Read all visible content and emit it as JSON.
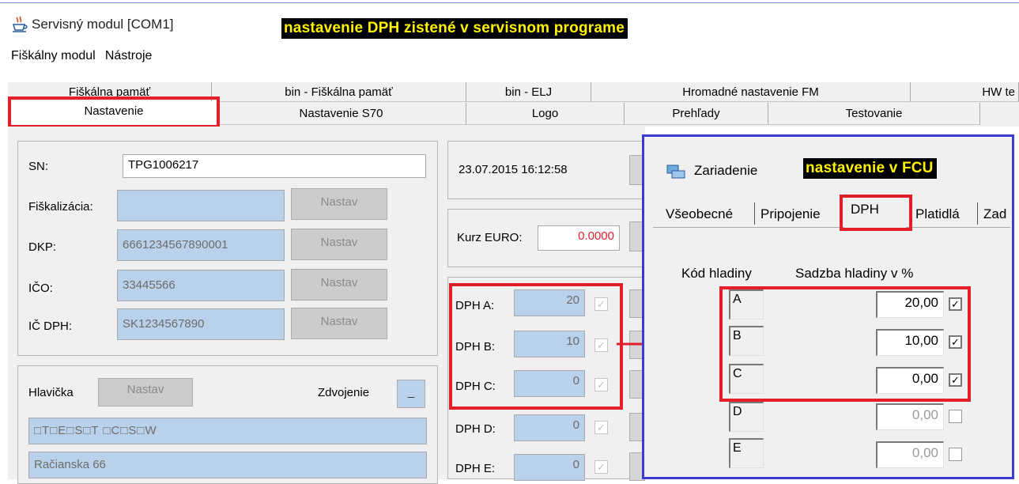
{
  "window": {
    "title": "Servisný modul [COM1]",
    "highlight": "nastavenie DPH zistené v servisnom programe"
  },
  "menu": {
    "items": [
      "Fiškálny modul",
      "Nástroje"
    ]
  },
  "tabs": {
    "row1": [
      "Fiškálna pamäť",
      "bin - Fiškálna pamäť",
      "bin - ELJ",
      "Hromadné nastavenie FM",
      "HW te"
    ],
    "row2": [
      "Nastavenie",
      "Nastavenie S70",
      "Logo",
      "Prehľady",
      "Testovanie"
    ],
    "active": "Nastavenie"
  },
  "form": {
    "sn_label": "SN:",
    "sn_value": "TPG1006217",
    "fisk_label": "Fiškalizácia:",
    "fisk_value": "",
    "dkp_label": "DKP:",
    "dkp_value": "6661234567890001",
    "ico_label": "IČO:",
    "ico_value": "33445566",
    "icdph_label": "IČ DPH:",
    "icdph_value": "SK1234567890",
    "set_button": "Nastav",
    "header_label": "Hlavička",
    "double_label": "Zdvojenie",
    "double_button": "_",
    "header_line1": "□T□E□S□T □C□S□W",
    "header_line2": "Račianska 66"
  },
  "datetime": "23.07.2015 16:12:58",
  "euro": {
    "label": "Kurz EURO:",
    "value": "0.0000"
  },
  "vat": [
    {
      "label": "DPH A:",
      "value": "20"
    },
    {
      "label": "DPH B:",
      "value": "10"
    },
    {
      "label": "DPH C:",
      "value": "0"
    },
    {
      "label": "DPH D:",
      "value": "0"
    },
    {
      "label": "DPH E:",
      "value": "0"
    }
  ],
  "fcu": {
    "title": "Zariadenie",
    "highlight": "nastavenie v  FCU",
    "tabs": [
      "Všeobecné",
      "Pripojenie",
      "DPH",
      "Platidlá",
      "Zad"
    ],
    "active_tab": "DPH",
    "col_code": "Kód hladiny",
    "col_rate": "Sadzba hladiny v %",
    "rows": [
      {
        "code": "A",
        "rate": "20,00",
        "checked": true
      },
      {
        "code": "B",
        "rate": "10,00",
        "checked": true
      },
      {
        "code": "C",
        "rate": "0,00",
        "checked": true
      },
      {
        "code": "D",
        "rate": "0,00",
        "checked": false
      },
      {
        "code": "E",
        "rate": "0,00",
        "checked": false
      }
    ]
  },
  "colors": {
    "annotation_red": "#e3202a",
    "annotation_blue": "#3b3bd1",
    "field_blue": "#b9d1ea",
    "highlight_yellow": "#fff200"
  },
  "icons": {
    "app": "java-cup-icon",
    "device": "device-icon",
    "arrow": "arrow-right-icon"
  }
}
